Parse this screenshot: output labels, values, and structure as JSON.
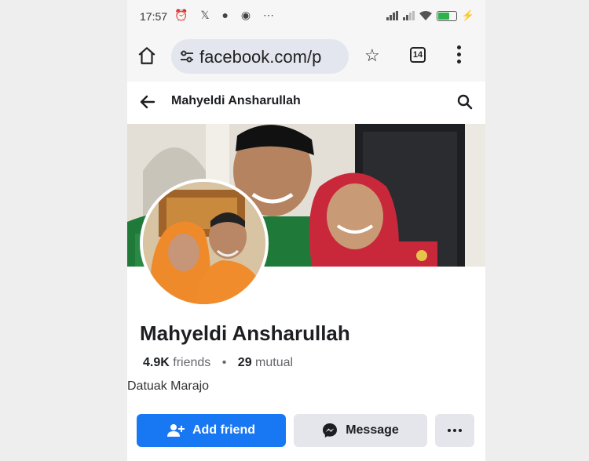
{
  "status_bar": {
    "time": "17:57",
    "left_icons": "⏰ 𝕏 ● ◉ ⋯",
    "right_icons": [
      "signal-bars",
      "signal-bars-2",
      "wifi-icon",
      "battery-icon"
    ],
    "battery_label": "⚡"
  },
  "browser": {
    "url": "facebook.com/p",
    "tab_count": "14",
    "icons": [
      "home-icon",
      "tune-icon",
      "star-icon",
      "tabs-icon",
      "menu-icon"
    ]
  },
  "header": {
    "title": "Mahyeldi Ansharullah",
    "icons": [
      "back-arrow-icon",
      "search-icon"
    ]
  },
  "profile": {
    "name": "Mahyeldi Ansharullah",
    "friends_count": "4.9K",
    "friends_label": "friends",
    "separator": "•",
    "mutual_count": "29",
    "mutual_label": "mutual",
    "bio": "Datuak Marajo"
  },
  "actions": {
    "add_friend_label": "Add friend",
    "message_label": "Message",
    "more_label": "···"
  },
  "colors": {
    "primary_button": "#1877f2",
    "secondary_button": "#e4e6eb",
    "text_primary": "#1c1e21",
    "text_secondary": "#65676b"
  }
}
